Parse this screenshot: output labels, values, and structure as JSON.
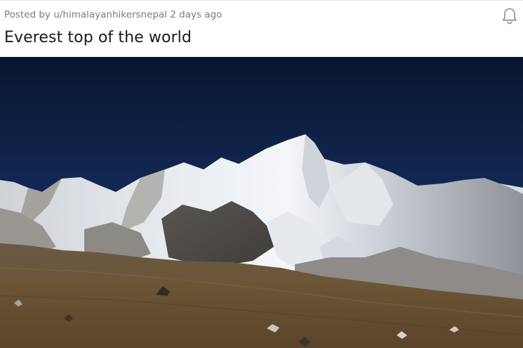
{
  "post": {
    "posted_by_prefix": "Posted by",
    "author": "u/himalayanhikersnepal",
    "time_ago": "2 days ago",
    "title": "Everest top of the world",
    "notification_icon": "bell-icon"
  },
  "media": {
    "kind": "photo",
    "subject": "mountain-landscape",
    "colors": {
      "sky_top": "#0b1a3a",
      "sky_bottom": "#1f3f7a",
      "snow": "#eef1f5",
      "rock": "#6d6a66",
      "ground": "#6a5534"
    }
  }
}
